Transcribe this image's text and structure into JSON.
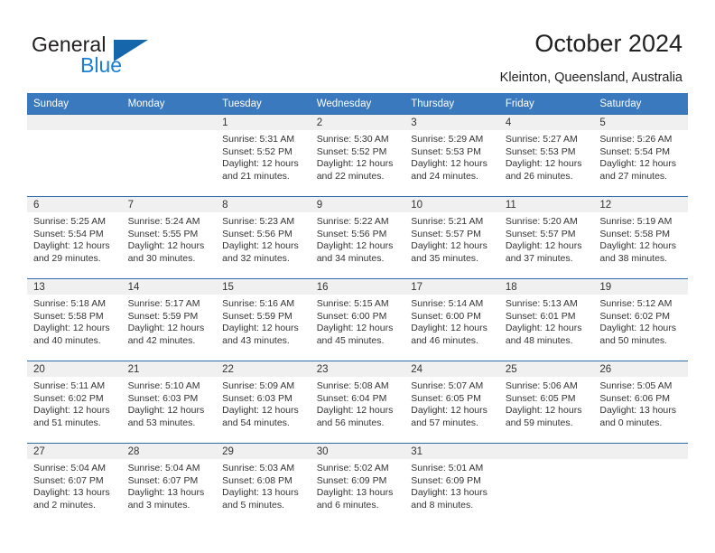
{
  "brand": {
    "name_top": "General",
    "name_bottom": "Blue",
    "color_dark": "#221f1f",
    "color_blue": "#1a7fd4",
    "triangle_color": "#1566ab"
  },
  "header": {
    "title": "October 2024",
    "location": "Kleinton, Queensland, Australia"
  },
  "theme": {
    "header_row_bg": "#3a79bd",
    "header_row_text": "#ffffff",
    "row_divider": "#2e6da8",
    "daynum_band_bg": "#f0f0f0",
    "page_bg": "#ffffff",
    "body_text": "#333333"
  },
  "weekday_headers": [
    "Sunday",
    "Monday",
    "Tuesday",
    "Wednesday",
    "Thursday",
    "Friday",
    "Saturday"
  ],
  "weeks": [
    [
      {
        "day": "",
        "sunrise": "",
        "sunset": "",
        "daylight_line1": "",
        "daylight_line2": ""
      },
      {
        "day": "",
        "sunrise": "",
        "sunset": "",
        "daylight_line1": "",
        "daylight_line2": ""
      },
      {
        "day": "1",
        "sunrise": "Sunrise: 5:31 AM",
        "sunset": "Sunset: 5:52 PM",
        "daylight_line1": "Daylight: 12 hours",
        "daylight_line2": "and 21 minutes."
      },
      {
        "day": "2",
        "sunrise": "Sunrise: 5:30 AM",
        "sunset": "Sunset: 5:52 PM",
        "daylight_line1": "Daylight: 12 hours",
        "daylight_line2": "and 22 minutes."
      },
      {
        "day": "3",
        "sunrise": "Sunrise: 5:29 AM",
        "sunset": "Sunset: 5:53 PM",
        "daylight_line1": "Daylight: 12 hours",
        "daylight_line2": "and 24 minutes."
      },
      {
        "day": "4",
        "sunrise": "Sunrise: 5:27 AM",
        "sunset": "Sunset: 5:53 PM",
        "daylight_line1": "Daylight: 12 hours",
        "daylight_line2": "and 26 minutes."
      },
      {
        "day": "5",
        "sunrise": "Sunrise: 5:26 AM",
        "sunset": "Sunset: 5:54 PM",
        "daylight_line1": "Daylight: 12 hours",
        "daylight_line2": "and 27 minutes."
      }
    ],
    [
      {
        "day": "6",
        "sunrise": "Sunrise: 5:25 AM",
        "sunset": "Sunset: 5:54 PM",
        "daylight_line1": "Daylight: 12 hours",
        "daylight_line2": "and 29 minutes."
      },
      {
        "day": "7",
        "sunrise": "Sunrise: 5:24 AM",
        "sunset": "Sunset: 5:55 PM",
        "daylight_line1": "Daylight: 12 hours",
        "daylight_line2": "and 30 minutes."
      },
      {
        "day": "8",
        "sunrise": "Sunrise: 5:23 AM",
        "sunset": "Sunset: 5:56 PM",
        "daylight_line1": "Daylight: 12 hours",
        "daylight_line2": "and 32 minutes."
      },
      {
        "day": "9",
        "sunrise": "Sunrise: 5:22 AM",
        "sunset": "Sunset: 5:56 PM",
        "daylight_line1": "Daylight: 12 hours",
        "daylight_line2": "and 34 minutes."
      },
      {
        "day": "10",
        "sunrise": "Sunrise: 5:21 AM",
        "sunset": "Sunset: 5:57 PM",
        "daylight_line1": "Daylight: 12 hours",
        "daylight_line2": "and 35 minutes."
      },
      {
        "day": "11",
        "sunrise": "Sunrise: 5:20 AM",
        "sunset": "Sunset: 5:57 PM",
        "daylight_line1": "Daylight: 12 hours",
        "daylight_line2": "and 37 minutes."
      },
      {
        "day": "12",
        "sunrise": "Sunrise: 5:19 AM",
        "sunset": "Sunset: 5:58 PM",
        "daylight_line1": "Daylight: 12 hours",
        "daylight_line2": "and 38 minutes."
      }
    ],
    [
      {
        "day": "13",
        "sunrise": "Sunrise: 5:18 AM",
        "sunset": "Sunset: 5:58 PM",
        "daylight_line1": "Daylight: 12 hours",
        "daylight_line2": "and 40 minutes."
      },
      {
        "day": "14",
        "sunrise": "Sunrise: 5:17 AM",
        "sunset": "Sunset: 5:59 PM",
        "daylight_line1": "Daylight: 12 hours",
        "daylight_line2": "and 42 minutes."
      },
      {
        "day": "15",
        "sunrise": "Sunrise: 5:16 AM",
        "sunset": "Sunset: 5:59 PM",
        "daylight_line1": "Daylight: 12 hours",
        "daylight_line2": "and 43 minutes."
      },
      {
        "day": "16",
        "sunrise": "Sunrise: 5:15 AM",
        "sunset": "Sunset: 6:00 PM",
        "daylight_line1": "Daylight: 12 hours",
        "daylight_line2": "and 45 minutes."
      },
      {
        "day": "17",
        "sunrise": "Sunrise: 5:14 AM",
        "sunset": "Sunset: 6:00 PM",
        "daylight_line1": "Daylight: 12 hours",
        "daylight_line2": "and 46 minutes."
      },
      {
        "day": "18",
        "sunrise": "Sunrise: 5:13 AM",
        "sunset": "Sunset: 6:01 PM",
        "daylight_line1": "Daylight: 12 hours",
        "daylight_line2": "and 48 minutes."
      },
      {
        "day": "19",
        "sunrise": "Sunrise: 5:12 AM",
        "sunset": "Sunset: 6:02 PM",
        "daylight_line1": "Daylight: 12 hours",
        "daylight_line2": "and 50 minutes."
      }
    ],
    [
      {
        "day": "20",
        "sunrise": "Sunrise: 5:11 AM",
        "sunset": "Sunset: 6:02 PM",
        "daylight_line1": "Daylight: 12 hours",
        "daylight_line2": "and 51 minutes."
      },
      {
        "day": "21",
        "sunrise": "Sunrise: 5:10 AM",
        "sunset": "Sunset: 6:03 PM",
        "daylight_line1": "Daylight: 12 hours",
        "daylight_line2": "and 53 minutes."
      },
      {
        "day": "22",
        "sunrise": "Sunrise: 5:09 AM",
        "sunset": "Sunset: 6:03 PM",
        "daylight_line1": "Daylight: 12 hours",
        "daylight_line2": "and 54 minutes."
      },
      {
        "day": "23",
        "sunrise": "Sunrise: 5:08 AM",
        "sunset": "Sunset: 6:04 PM",
        "daylight_line1": "Daylight: 12 hours",
        "daylight_line2": "and 56 minutes."
      },
      {
        "day": "24",
        "sunrise": "Sunrise: 5:07 AM",
        "sunset": "Sunset: 6:05 PM",
        "daylight_line1": "Daylight: 12 hours",
        "daylight_line2": "and 57 minutes."
      },
      {
        "day": "25",
        "sunrise": "Sunrise: 5:06 AM",
        "sunset": "Sunset: 6:05 PM",
        "daylight_line1": "Daylight: 12 hours",
        "daylight_line2": "and 59 minutes."
      },
      {
        "day": "26",
        "sunrise": "Sunrise: 5:05 AM",
        "sunset": "Sunset: 6:06 PM",
        "daylight_line1": "Daylight: 13 hours",
        "daylight_line2": "and 0 minutes."
      }
    ],
    [
      {
        "day": "27",
        "sunrise": "Sunrise: 5:04 AM",
        "sunset": "Sunset: 6:07 PM",
        "daylight_line1": "Daylight: 13 hours",
        "daylight_line2": "and 2 minutes."
      },
      {
        "day": "28",
        "sunrise": "Sunrise: 5:04 AM",
        "sunset": "Sunset: 6:07 PM",
        "daylight_line1": "Daylight: 13 hours",
        "daylight_line2": "and 3 minutes."
      },
      {
        "day": "29",
        "sunrise": "Sunrise: 5:03 AM",
        "sunset": "Sunset: 6:08 PM",
        "daylight_line1": "Daylight: 13 hours",
        "daylight_line2": "and 5 minutes."
      },
      {
        "day": "30",
        "sunrise": "Sunrise: 5:02 AM",
        "sunset": "Sunset: 6:09 PM",
        "daylight_line1": "Daylight: 13 hours",
        "daylight_line2": "and 6 minutes."
      },
      {
        "day": "31",
        "sunrise": "Sunrise: 5:01 AM",
        "sunset": "Sunset: 6:09 PM",
        "daylight_line1": "Daylight: 13 hours",
        "daylight_line2": "and 8 minutes."
      },
      {
        "day": "",
        "sunrise": "",
        "sunset": "",
        "daylight_line1": "",
        "daylight_line2": ""
      },
      {
        "day": "",
        "sunrise": "",
        "sunset": "",
        "daylight_line1": "",
        "daylight_line2": ""
      }
    ]
  ]
}
